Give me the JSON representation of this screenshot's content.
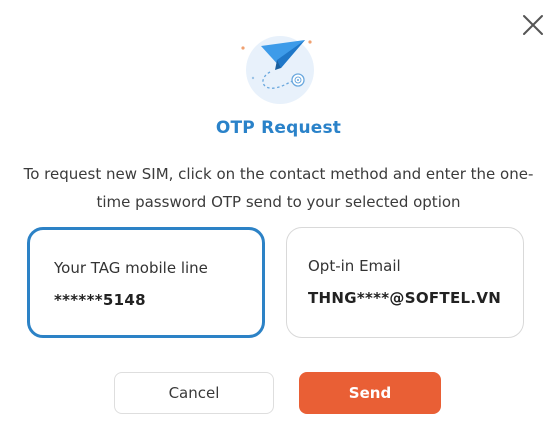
{
  "dialog": {
    "title": "OTP Request",
    "description": "To request new SIM, click on the contact method and enter the one-time password OTP send to your selected option",
    "close_icon": "close-icon",
    "hero_icon": "paper-plane-icon"
  },
  "options": [
    {
      "label": "Your TAG mobile line",
      "value": "******5148",
      "selected": true
    },
    {
      "label": "Opt-in Email",
      "value": "THNG****@SOFTEL.VN",
      "selected": false
    }
  ],
  "actions": {
    "cancel_label": "Cancel",
    "send_label": "Send"
  },
  "colors": {
    "accent_blue": "#2a82c9",
    "selected_border": "#2c82c6",
    "send_button": "#e95f35",
    "hero_circle": "#e8f1fb"
  }
}
